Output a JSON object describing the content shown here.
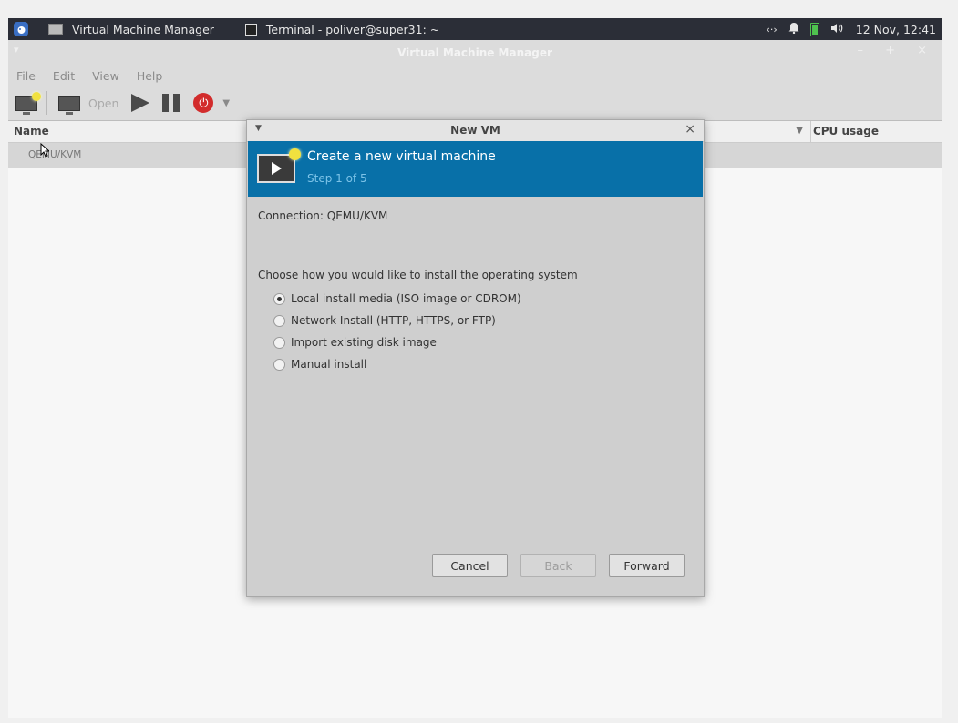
{
  "panel": {
    "tasks": [
      {
        "label": "Virtual Machine Manager"
      },
      {
        "label": "Terminal - poliver@super31: ~"
      }
    ],
    "tray": {
      "network_icon": "network-icon",
      "bell_icon": "bell-icon",
      "battery_icon": "battery-icon",
      "volume_icon": "volume-icon",
      "clock": "12 Nov, 12:41"
    }
  },
  "main": {
    "window_title": "Virtual Machine Manager",
    "menu": [
      "File",
      "Edit",
      "View",
      "Help"
    ],
    "toolbar": {
      "open_label": "Open"
    },
    "columns": {
      "name": "Name",
      "cpu": "CPU usage"
    },
    "connection_row": "QEMU/KVM"
  },
  "dialog": {
    "title": "New VM",
    "banner_title": "Create a new virtual machine",
    "step": "Step 1 of 5",
    "connection_text": "Connection:  QEMU/KVM",
    "prompt": "Choose how you would like to install the operating system",
    "options": [
      {
        "label": "Local install media (ISO image or CDROM)",
        "selected": true
      },
      {
        "label": "Network Install (HTTP, HTTPS, or FTP)",
        "selected": false
      },
      {
        "label": "Import existing disk image",
        "selected": false
      },
      {
        "label": "Manual install",
        "selected": false
      }
    ],
    "buttons": {
      "cancel": "Cancel",
      "back": "Back",
      "forward": "Forward"
    }
  },
  "colors": {
    "banner": "#0870a8",
    "panel": "#2b2e37",
    "power_button": "#d22c2c"
  }
}
